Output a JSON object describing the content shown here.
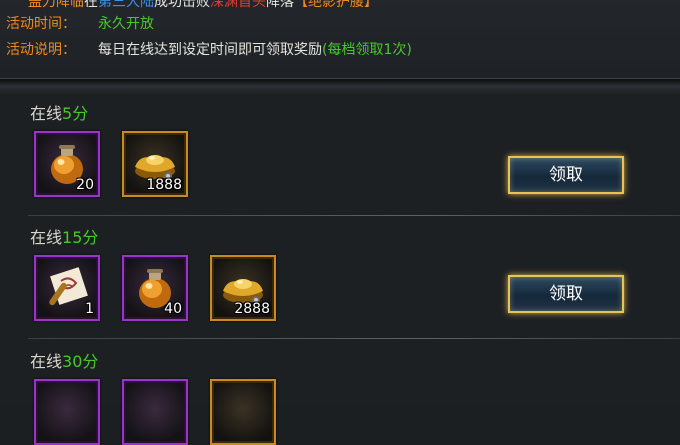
{
  "info": {
    "top_line": {
      "part1": "盖力降临",
      "part2": "在",
      "part3": "第三大陆",
      "part4": "成功击败",
      "part5": "深渊首头",
      "part6": "降落",
      "part7": "【绝影护腰】"
    },
    "time_label": "活动时间：",
    "time_value": "永久开放",
    "desc_label": "活动说明：",
    "desc_value": "每日在线达到设定时间即可领取奖励",
    "desc_note": "(每档领取1次)"
  },
  "tiers": [
    {
      "title_prefix": "在线",
      "title_value": "5分",
      "items": [
        {
          "icon": "potion-icon",
          "count": "20",
          "rarity": "purple"
        },
        {
          "icon": "gold-ingot-icon",
          "count": "1888",
          "rarity": "gold"
        }
      ],
      "button": "领取"
    },
    {
      "title_prefix": "在线",
      "title_value": "15分",
      "items": [
        {
          "icon": "scroll-icon",
          "count": "1",
          "rarity": "purple"
        },
        {
          "icon": "potion-icon",
          "count": "40",
          "rarity": "purple"
        },
        {
          "icon": "gold-ingot-icon",
          "count": "2888",
          "rarity": "gold"
        }
      ],
      "button": "领取"
    },
    {
      "title_prefix": "在线",
      "title_value": "30分",
      "items": [
        {
          "icon": "scroll-icon",
          "rarity": "purple"
        },
        {
          "icon": "potion-icon",
          "rarity": "purple"
        },
        {
          "icon": "gold-ingot-icon",
          "rarity": "gold"
        }
      ]
    }
  ],
  "colors": {
    "label_orange": "#f08a1e",
    "value_green": "#49c928",
    "purple_border": "#9b34c9",
    "gold_border": "#c98a1f",
    "button_border": "#e8c458"
  }
}
